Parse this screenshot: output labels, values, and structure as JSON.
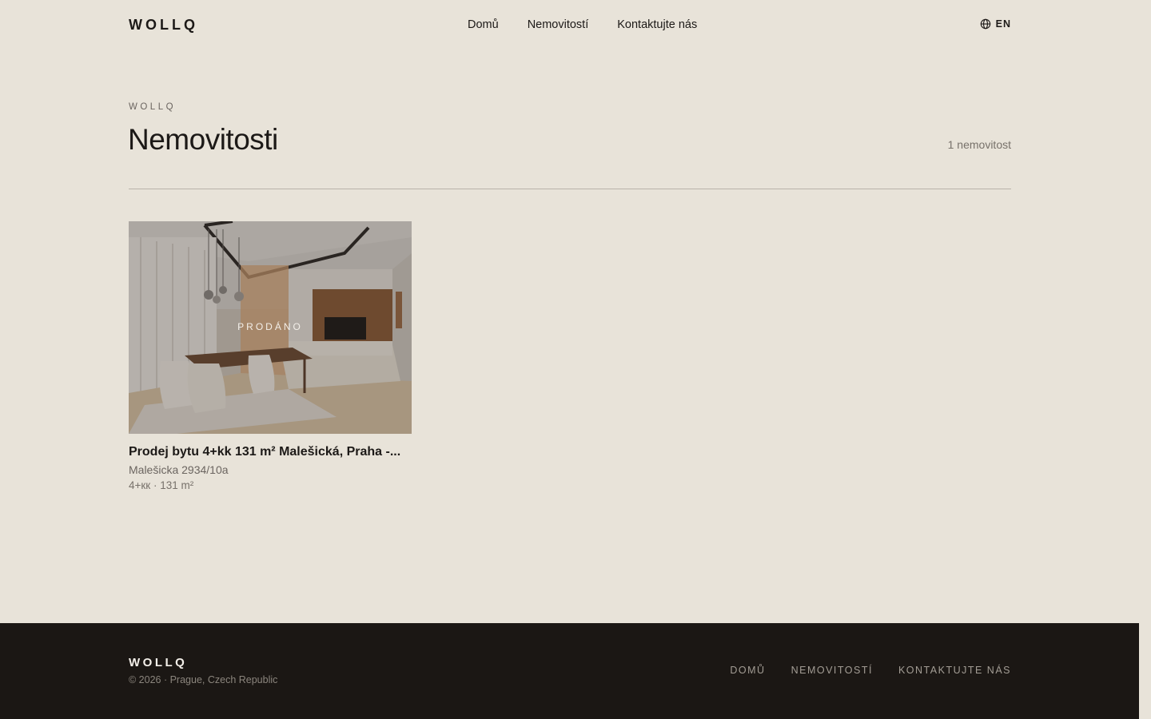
{
  "header": {
    "logo": "WOLLQ",
    "nav": [
      {
        "label": "Domů"
      },
      {
        "label": "Nemovitostí"
      },
      {
        "label": "Kontaktujte nás"
      }
    ],
    "language": "EN",
    "language_icon": "globe-icon"
  },
  "main": {
    "eyebrow": "WOLLQ",
    "title": "Nemovitosti",
    "count": "1 nemovitost"
  },
  "listings": [
    {
      "badge": "PRODÁNO",
      "title": "Prodej bytu 4+kk 131 m² Malešická, Praha -...",
      "address": "Malešicka 2934/10a",
      "meta": "4+кк · 131 m²",
      "image_description": "interior-living-dining-room"
    }
  ],
  "footer": {
    "logo": "WOLLQ",
    "copyright": "© 2026 · Prague, Czech Republic",
    "nav": [
      {
        "label": "DOMŮ"
      },
      {
        "label": "NEMOVITOSTÍ"
      },
      {
        "label": "KONTAKTUJTE NÁS"
      }
    ]
  },
  "colors": {
    "background": "#e8e3d9",
    "text": "#1c1917",
    "footer_bg": "#1b1714"
  }
}
